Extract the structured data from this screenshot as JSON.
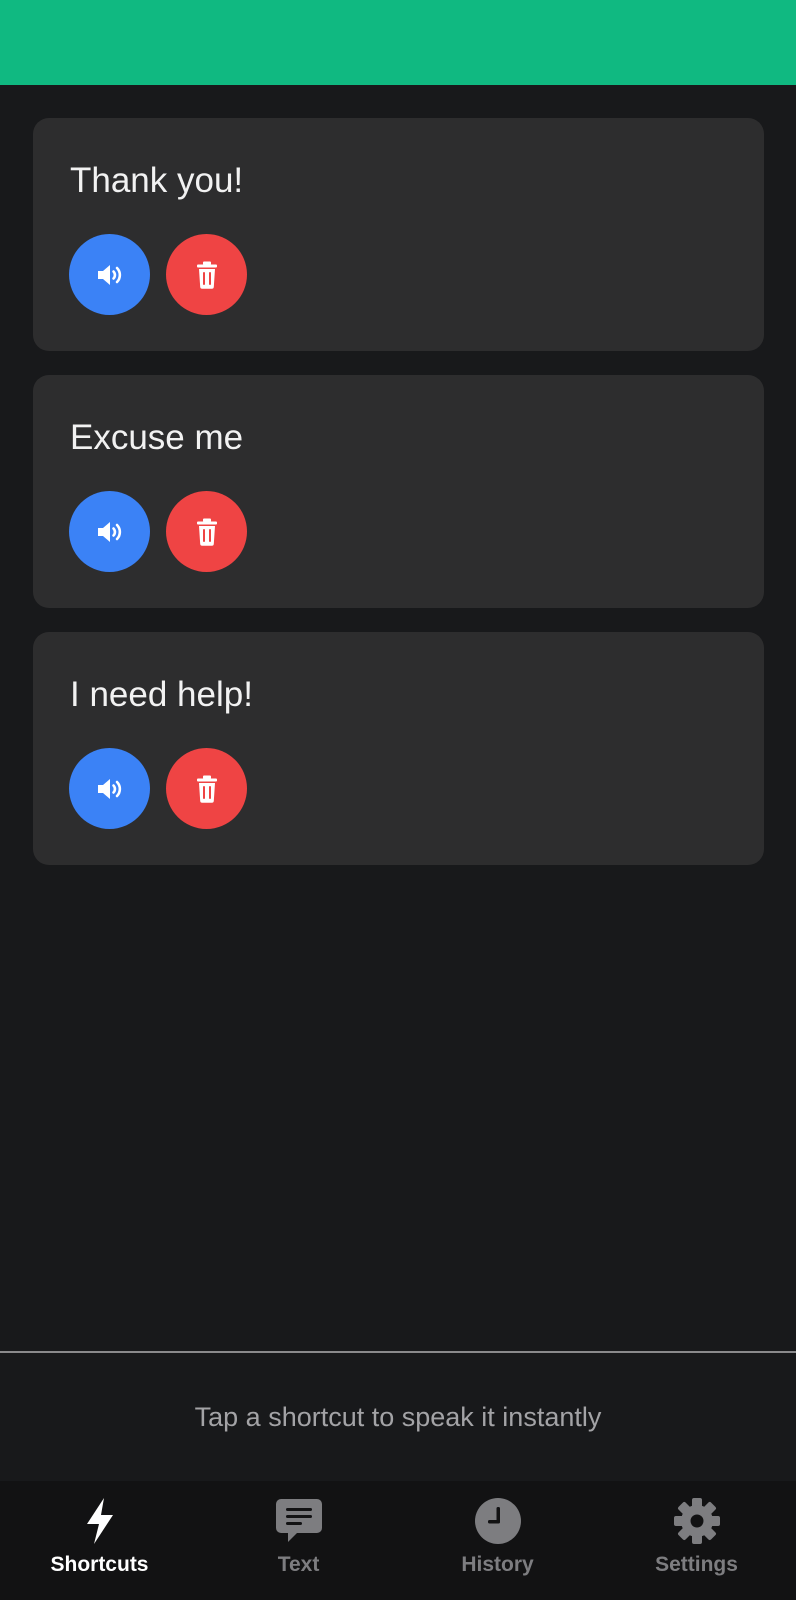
{
  "colors": {
    "header": "#10b981",
    "speak_button": "#3b82f6",
    "delete_button": "#ef4444",
    "card_background": "#2d2d2e",
    "page_background": "#18191b"
  },
  "shortcuts": [
    {
      "text": "Thank you!",
      "speak_icon": "speaker-icon",
      "delete_icon": "trash-icon"
    },
    {
      "text": "Excuse me",
      "speak_icon": "speaker-icon",
      "delete_icon": "trash-icon"
    },
    {
      "text": "I need help!",
      "speak_icon": "speaker-icon",
      "delete_icon": "trash-icon"
    }
  ],
  "hint": "Tap a shortcut to speak it instantly",
  "tabs": [
    {
      "label": "Shortcuts",
      "icon": "lightning-bolt-icon",
      "active": true
    },
    {
      "label": "Text",
      "icon": "chat-bubble-icon",
      "active": false
    },
    {
      "label": "History",
      "icon": "clock-icon",
      "active": false
    },
    {
      "label": "Settings",
      "icon": "gear-icon",
      "active": false
    }
  ]
}
